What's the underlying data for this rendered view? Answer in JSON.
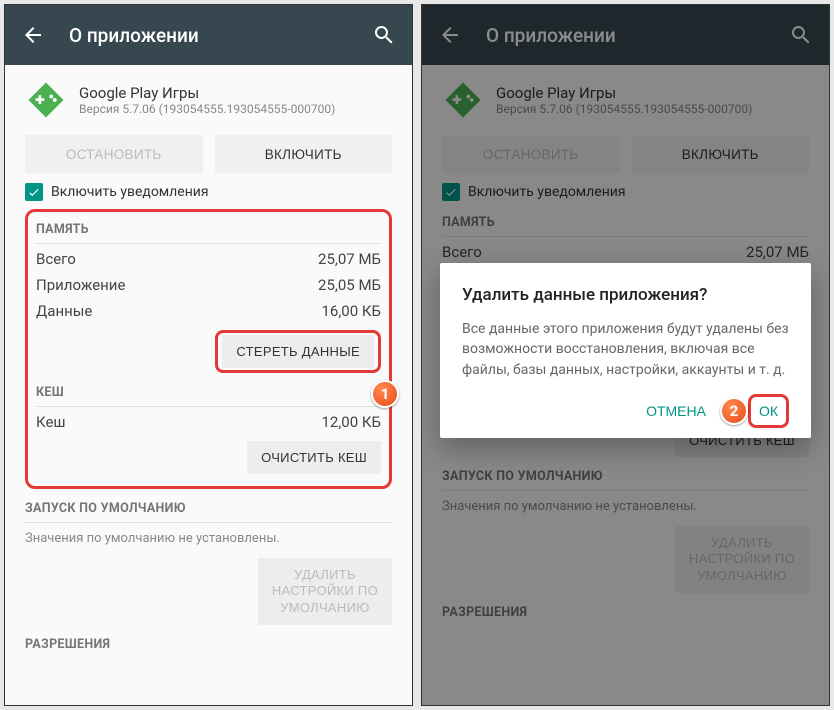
{
  "appbar": {
    "title": "О приложении"
  },
  "app": {
    "name": "Google Play Игры",
    "version": "Версия 5.7.06 (193054555.193054555-000700)"
  },
  "buttons": {
    "stop": "ОСТАНОВИТЬ",
    "enable": "ВКЛЮЧИТЬ",
    "clear_data": "СТЕРЕТЬ ДАННЫЕ",
    "clear_cache": "ОЧИСТИТЬ КЕШ",
    "clear_defaults": "УДАЛИТЬ\nНАСТРОЙКИ ПО\nУМОЛЧАНИЮ"
  },
  "notify_label": "Включить уведомления",
  "sections": {
    "storage": "ПАМЯТЬ",
    "cache": "КЕШ",
    "defaults": "ЗАПУСК ПО УМОЛЧАНИЮ",
    "permissions": "РАЗРЕШЕНИЯ"
  },
  "storage": {
    "total_label": "Всего",
    "total_value": "25,07 МБ",
    "app_label": "Приложение",
    "app_value": "25,05 МБ",
    "data_label": "Данные",
    "data_value": "16,00 КБ"
  },
  "cache": {
    "label": "Кеш",
    "value": "12,00 КБ"
  },
  "defaults_note": "Значения по умолчанию не установлены.",
  "dialog": {
    "title": "Удалить данные приложения?",
    "body": "Все данные этого приложения будут удалены без возможности восстановления, включая все файлы, базы данных, настройки, аккаунты и т. д.",
    "cancel": "ОТМЕНА",
    "ok": "ОК"
  },
  "badges": {
    "one": "1",
    "two": "2"
  }
}
